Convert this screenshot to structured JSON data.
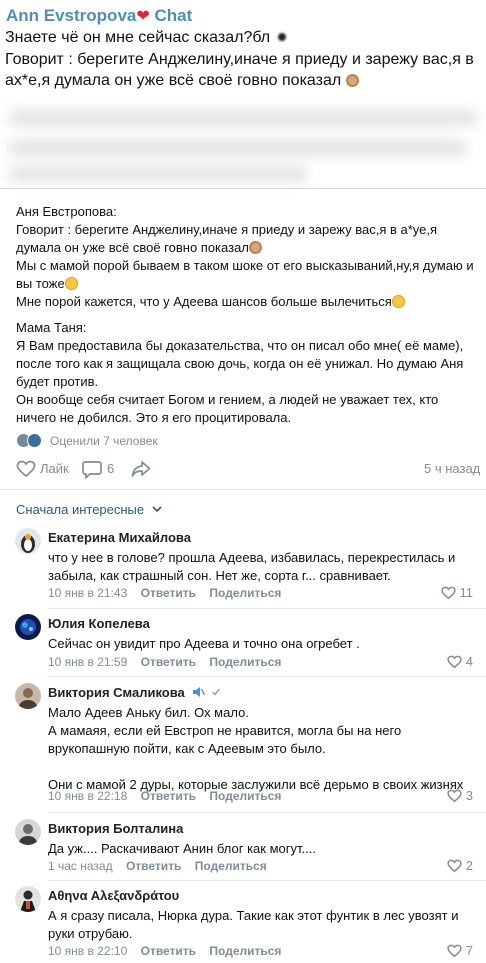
{
  "story": {
    "title": "Ann Evstropova",
    "title_suffix": "Chat",
    "line1": "Знаете чё он мне сейчас сказал?бл",
    "line2": "Говорит : берегите Анджелину,иначе я приеду и зарежу вас,я в",
    "line3": "ах*е,я думала он уже всё своё говно показал"
  },
  "post": {
    "author1": "Аня Евстропова:",
    "p1": "Говорит : берегите Анджелину,иначе я приеду и зарежу вас,я в а*уе,я думала он уже всё своё говно показал",
    "p2": "Мы с мамой порой бываем в таком шоке от его высказываний,ну,я думаю и вы тоже",
    "p3": "Мне порой кажется, что у Адеева шансов больше вылечиться",
    "author2": "Мама Таня:",
    "p4": "Я Вам предоставила бы доказательства, что он писал обо мне( её маме), после того как я защищала свою дочь, когда он её унижал. Но думаю Аня будет против.",
    "p5": "Он вообще себя считает Богом и гением, а людей не уважает тех, кто ничего не добился. Это я его процитировала."
  },
  "rated": {
    "text": "Оценили 7 человек"
  },
  "actions": {
    "like": "Лайк",
    "comments": "6",
    "time": "5 ч назад"
  },
  "sort": {
    "label": "Сначала интересные"
  },
  "meta_labels": {
    "reply": "Ответить",
    "share": "Поделиться"
  },
  "comments": [
    {
      "name": "Екатерина Михайлова",
      "text": "что у нее в голове? прошла Адеева, избавилась, перекрестилась и забыла, как страшный сон. Нет же, сорта г... сравнивает.",
      "time": "10 янв в 21:43",
      "likes": "11"
    },
    {
      "name": "Юлия Копелева",
      "text": "Сейчас он увидит про Адеева и точно она огребет .",
      "time": "10 янв в 21:59",
      "likes": "4"
    },
    {
      "name": "Виктория Смаликова",
      "text": "Мало Адеев Аньку бил. Ох мало.\nА мамаяя, если ей Евстроп не нравится, могла бы на него врукопашную пойти, как с Адеевым это было.\n\nОни с мамой 2 дуры, которые заслужили всё дерьмо в своих жизнях",
      "time": "10 янв в 22:18",
      "likes": "3"
    },
    {
      "name": "Виктория Болталина",
      "text": "Да уж.... Раскачивают Анин блог как могут....",
      "time": "1 час назад",
      "likes": "2"
    },
    {
      "name": "Αθηνα Αλεξανδράτου",
      "text": "А я сразу писала, Нюрка дура. Такие как этот фунтик в лес увозят и руки отрубаю.",
      "time": "10 янв в 22:10",
      "likes": "7"
    }
  ],
  "colors": {
    "link": "#2a5885",
    "title": "#4d8fb5",
    "muted": "#818c99"
  }
}
